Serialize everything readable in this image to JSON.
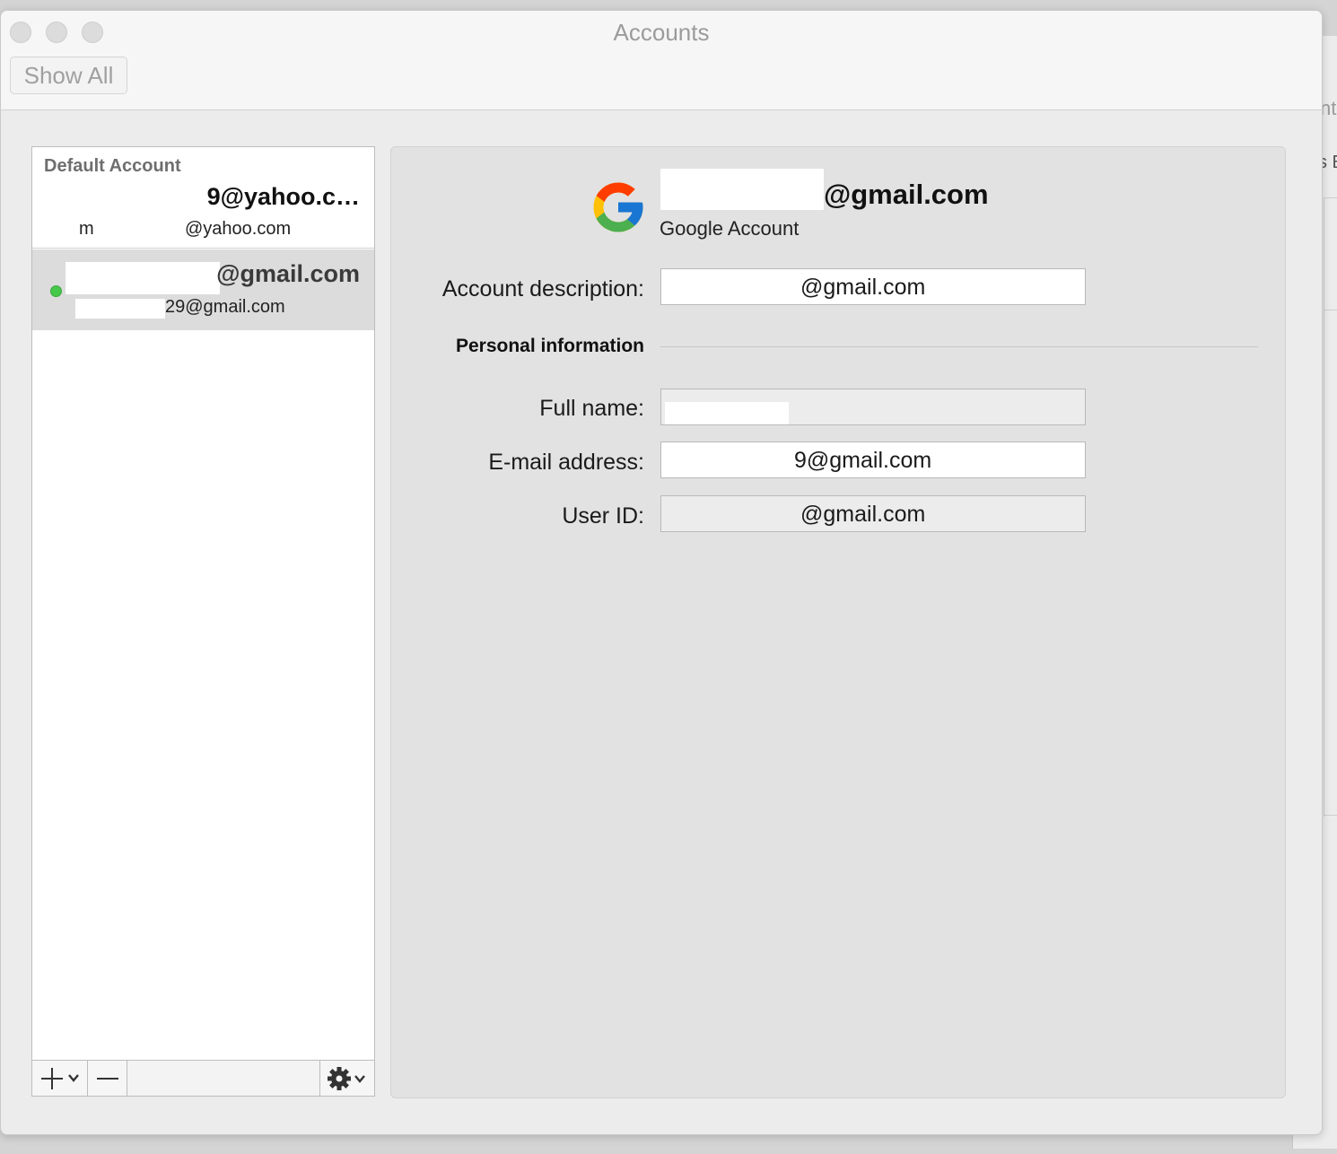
{
  "window": {
    "title": "Accounts",
    "show_all_label": "Show All"
  },
  "background_window": {
    "fragment_1": "nt",
    "fragment_2": "s E"
  },
  "account_list": {
    "section_header": "Default Account",
    "accounts": [
      {
        "primary": "9@yahoo.c…",
        "secondary_prefix": "m",
        "secondary": "@yahoo.com",
        "selected": false
      },
      {
        "primary": "@gmail.com",
        "secondary": "29@gmail.com",
        "status": "online",
        "status_color": "#46c94a",
        "selected": true
      }
    ],
    "toolbar": {
      "add_icon": "plus-icon",
      "add_menu_icon": "chevron-down-icon",
      "remove_icon": "minus-icon",
      "actions_icon": "gear-icon"
    }
  },
  "detail": {
    "header_email": "@gmail.com",
    "account_type": "Google Account",
    "account_description_label": "Account description:",
    "account_description_value": "@gmail.com",
    "personal_info_heading": "Personal information",
    "full_name_label": "Full name:",
    "full_name_value": "",
    "email_label": "E-mail address:",
    "email_value": "9@gmail.com",
    "user_id_label": "User ID:",
    "user_id_value": "@gmail.com",
    "logo": "google-logo"
  }
}
